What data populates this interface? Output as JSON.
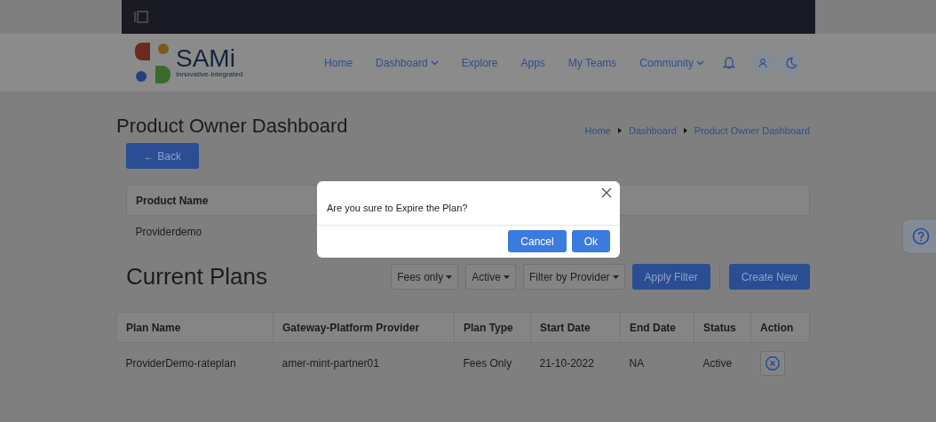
{
  "logo": {
    "name": "SAMi",
    "tagline": "Innovative-Integrated"
  },
  "nav": [
    {
      "label": "Home",
      "dropdown": false
    },
    {
      "label": "Dashboard",
      "dropdown": true
    },
    {
      "label": "Explore",
      "dropdown": false
    },
    {
      "label": "Apps",
      "dropdown": false
    },
    {
      "label": "My Teams",
      "dropdown": false
    },
    {
      "label": "Community",
      "dropdown": true
    }
  ],
  "page_title": "Product Owner Dashboard",
  "breadcrumb": [
    "Home",
    "Dashboard",
    "Product Owner Dashboard"
  ],
  "back_button": "← Back",
  "product_table": {
    "columns": [
      "Product Name"
    ],
    "rows": [
      [
        "Providerdemo"
      ]
    ]
  },
  "plans": {
    "title": "Current Plans",
    "filters": [
      {
        "label": "Fees only"
      },
      {
        "label": "Active"
      },
      {
        "label": "Filter by Provider"
      }
    ],
    "apply_button": "Apply Filter",
    "create_button": "Create New",
    "columns": [
      "Plan Name",
      "Gateway-Platform Provider",
      "Plan Type",
      "Start Date",
      "End Date",
      "Status",
      "Action"
    ],
    "rows": [
      {
        "cells": [
          "ProviderDemo-rateplan",
          "amer-mint-partner01",
          "Fees Only",
          "21-10-2022",
          "NA",
          "Active"
        ]
      }
    ]
  },
  "dialog": {
    "message": "Are you sure to Expire the Plan?",
    "buttons": [
      "Cancel",
      "Ok"
    ]
  }
}
